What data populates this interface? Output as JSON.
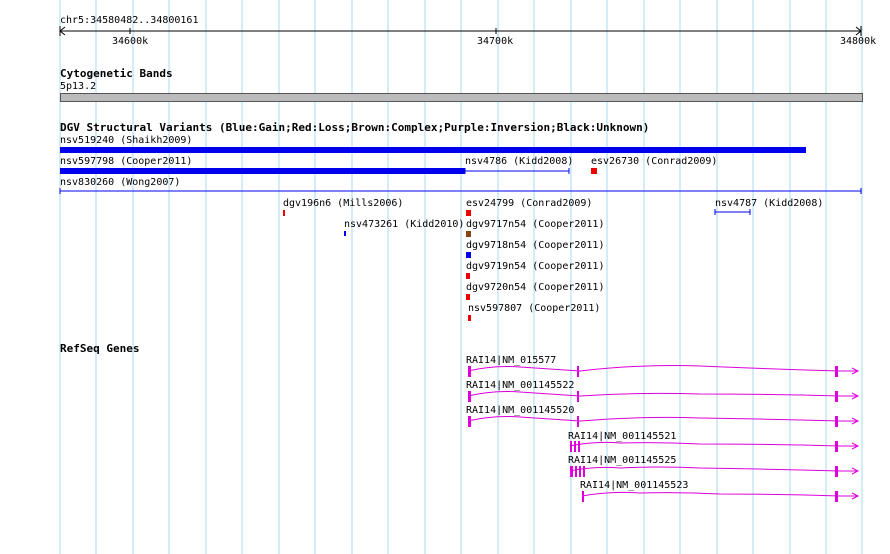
{
  "ruler": {
    "region": "chr5:34580482..34800161",
    "ticks": [
      "34600k",
      "34700k",
      "34800k"
    ]
  },
  "cytoband": {
    "title": "Cytogenetic Bands",
    "band": "5p13.2"
  },
  "dgv": {
    "title": "DGV Structural Variants (Blue:Gain;Red:Loss;Brown:Complex;Purple:Inversion;Black:Unknown)",
    "features": [
      {
        "label": "nsv519240 (Shaikh2009)",
        "color": "#0000ee"
      },
      {
        "label": "nsv597798 (Cooper2011)",
        "color": "#0000ee"
      },
      {
        "label": "nsv4786 (Kidd2008)",
        "color": "#0000ee"
      },
      {
        "label": "esv26730 (Conrad2009)",
        "color": "#ee0000"
      },
      {
        "label": "nsv830260 (Wong2007)",
        "color": "#0000ee"
      },
      {
        "label": "dgv196n6 (Mills2006)",
        "color": "#ee0000"
      },
      {
        "label": "esv24799 (Conrad2009)",
        "color": "#ee0000"
      },
      {
        "label": "nsv4787 (Kidd2008)",
        "color": "#0000ee"
      },
      {
        "label": "nsv473261 (Kidd2010)",
        "color": "#0000ee"
      },
      {
        "label": "dgv9717n54 (Cooper2011)",
        "color": "#8b4513"
      },
      {
        "label": "dgv9718n54 (Cooper2011)",
        "color": "#0000ee"
      },
      {
        "label": "dgv9719n54 (Cooper2011)",
        "color": "#ee0000"
      },
      {
        "label": "dgv9720n54 (Cooper2011)",
        "color": "#ee0000"
      },
      {
        "label": "nsv597807 (Cooper2011)",
        "color": "#ee0000"
      }
    ]
  },
  "refseq": {
    "title": "RefSeq Genes",
    "color": "#dd00dd",
    "genes": [
      {
        "label": "RAI14|NM_015577"
      },
      {
        "label": "RAI14|NM_001145522"
      },
      {
        "label": "RAI14|NM_001145520"
      },
      {
        "label": "RAI14|NM_001145521"
      },
      {
        "label": "RAI14|NM_001145525"
      },
      {
        "label": "RAI14|NM_001145523"
      }
    ]
  }
}
